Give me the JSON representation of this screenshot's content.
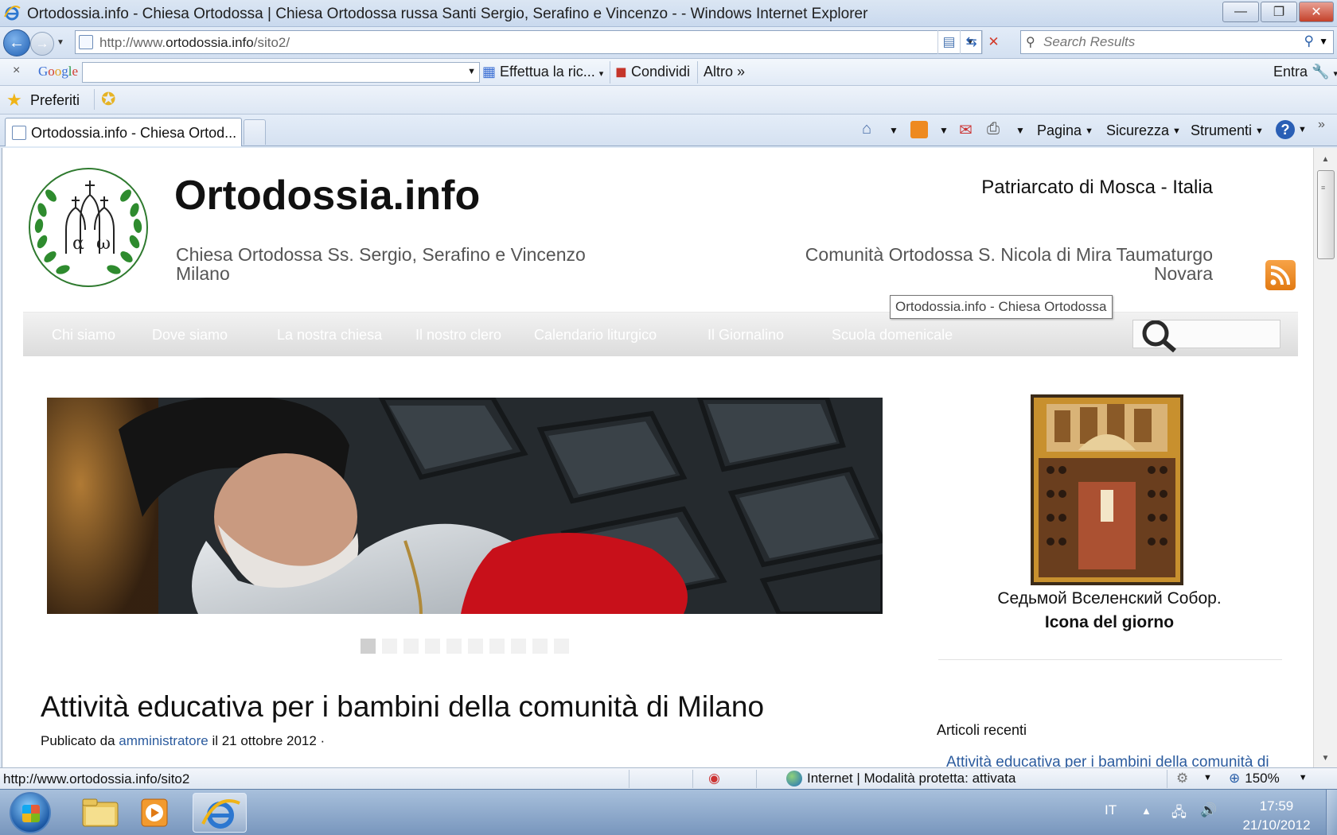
{
  "window": {
    "title": "Ortodossia.info - Chiesa Ortodossa | Chiesa Ortodossa russa Santi Sergio, Serafino e Vincenzo - - Windows Internet Explorer",
    "minimize": "—",
    "maximize": "❐",
    "close": "✕"
  },
  "navbar": {
    "back": "←",
    "forward": "→",
    "url_prefix": "http://www.",
    "url_domain": "ortodossia.info",
    "url_path": "/sito2/",
    "search_placeholder": "Search Results"
  },
  "googlebar": {
    "close": "×",
    "logo_g1": "G",
    "logo_o1": "o",
    "logo_o2": "o",
    "logo_g2": "g",
    "logo_l": "l",
    "logo_e": "e",
    "search_button": "Effettua la ric...",
    "share": "Condividi",
    "more": "Altro",
    "more_chevron": "»",
    "signin": "Entra"
  },
  "favbar": {
    "favorites": "Preferiti"
  },
  "tabs": [
    {
      "label": "Ortodossia.info - Chiesa Ortod..."
    }
  ],
  "commands": {
    "page": "Pagina",
    "safety": "Sicurezza",
    "tools": "Strumenti",
    "help": "?"
  },
  "page": {
    "site_title": "Ortodossia.info",
    "subtitle_left_line1": "Chiesa Ortodossa Ss. Sergio, Serafino e Vincenzo",
    "subtitle_left_line2": "Milano",
    "patriarchate": "Patriarcato di Mosca - Italia",
    "subtitle_right_line1": "Comunità Ortodossa S. Nicola di Mira Taumaturgo",
    "subtitle_right_line2": "Novara",
    "tooltip": "Ortodossia.info - Chiesa Ortodossa",
    "menu": [
      "Chi siamo",
      "Dove siamo",
      "La nostra chiesa",
      "Il nostro clero",
      "Calendario liturgico",
      "Il Giornalino",
      "Scuola domenicale"
    ],
    "slider_count": 10,
    "slider_active": 1,
    "icon_caption": "Седьмой Вселенский Собор.",
    "icon_of_day": "Icona del giorno",
    "recent_heading": "Articoli recenti",
    "recent_first": "Attività educativa per i bambini della comunità di",
    "post_title": "Attività educativa per i bambini della comunità di Milano",
    "post_meta_prefix": "Publicato da ",
    "post_meta_author": "amministratore",
    "post_meta_suffix": " il 21 ottobre 2012 ·"
  },
  "statusbar": {
    "url": "http://www.ortodossia.info/sito2",
    "zone": "Internet | Modalità protetta: attivata",
    "zoom": "150%"
  },
  "taskbar": {
    "language": "IT",
    "time": "17:59",
    "date": "21/10/2012"
  },
  "colors": {
    "link": "#2b5b9e",
    "menu_text": "#ffffff",
    "rss": "#e27a13"
  }
}
